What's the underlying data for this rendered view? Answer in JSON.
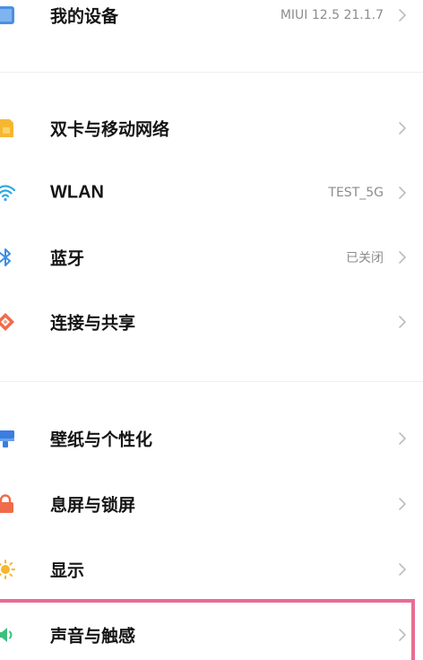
{
  "settings": {
    "my_device": {
      "label": "我的设备",
      "value": "MIUI 12.5 21.1.7",
      "icon": "phone-icon"
    },
    "sim": {
      "label": "双卡与移动网络",
      "value": "",
      "icon": "sim-card-icon"
    },
    "wlan": {
      "label": "WLAN",
      "value": "TEST_5G",
      "icon": "wifi-icon"
    },
    "bluetooth": {
      "label": "蓝牙",
      "value": "已关闭",
      "icon": "bluetooth-icon"
    },
    "connection": {
      "label": "连接与共享",
      "value": "",
      "icon": "share-icon"
    },
    "wallpaper": {
      "label": "壁纸与个性化",
      "value": "",
      "icon": "brush-icon"
    },
    "lock": {
      "label": "息屏与锁屏",
      "value": "",
      "icon": "lock-icon"
    },
    "display": {
      "label": "显示",
      "value": "",
      "icon": "sun-icon"
    },
    "sound": {
      "label": "声音与触感",
      "value": "",
      "icon": "speaker-icon"
    }
  },
  "colors": {
    "highlight_border": "#ea6b93",
    "chevron": "#bdbdbd",
    "value_text": "#8c8c8c",
    "divider": "#efefef"
  }
}
